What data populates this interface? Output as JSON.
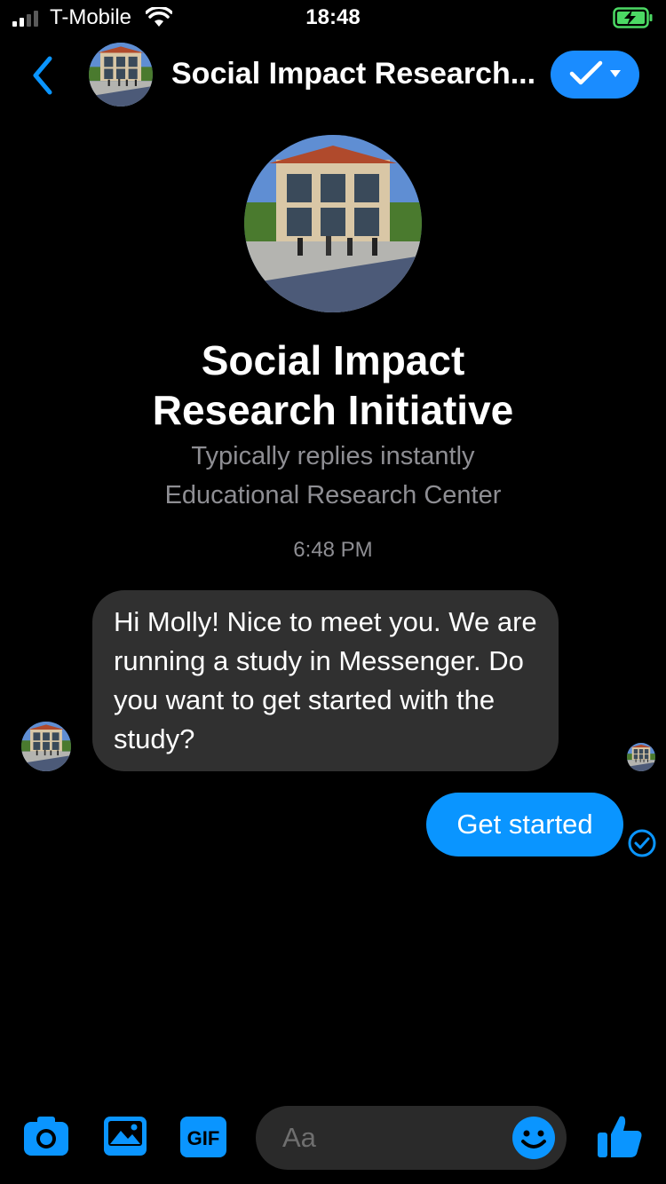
{
  "status_bar": {
    "carrier": "T-Mobile",
    "time": "18:48"
  },
  "header": {
    "title": "Social Impact Research..."
  },
  "profile": {
    "name_line1": "Social Impact",
    "name_line2": "Research Initiative",
    "reply_time": "Typically replies instantly",
    "category": "Educational Research Center"
  },
  "conversation": {
    "timestamp": "6:48 PM",
    "messages": [
      {
        "direction": "incoming",
        "text": "Hi Molly! Nice to meet you. We are running a study in Messenger. Do you want to get started with the study?"
      },
      {
        "direction": "outgoing",
        "text": "Get started"
      }
    ]
  },
  "composer": {
    "placeholder": "Aa",
    "gif_label": "GIF"
  },
  "colors": {
    "accent": "#0a95ff",
    "background": "#000000",
    "incoming_bubble": "#303030"
  }
}
